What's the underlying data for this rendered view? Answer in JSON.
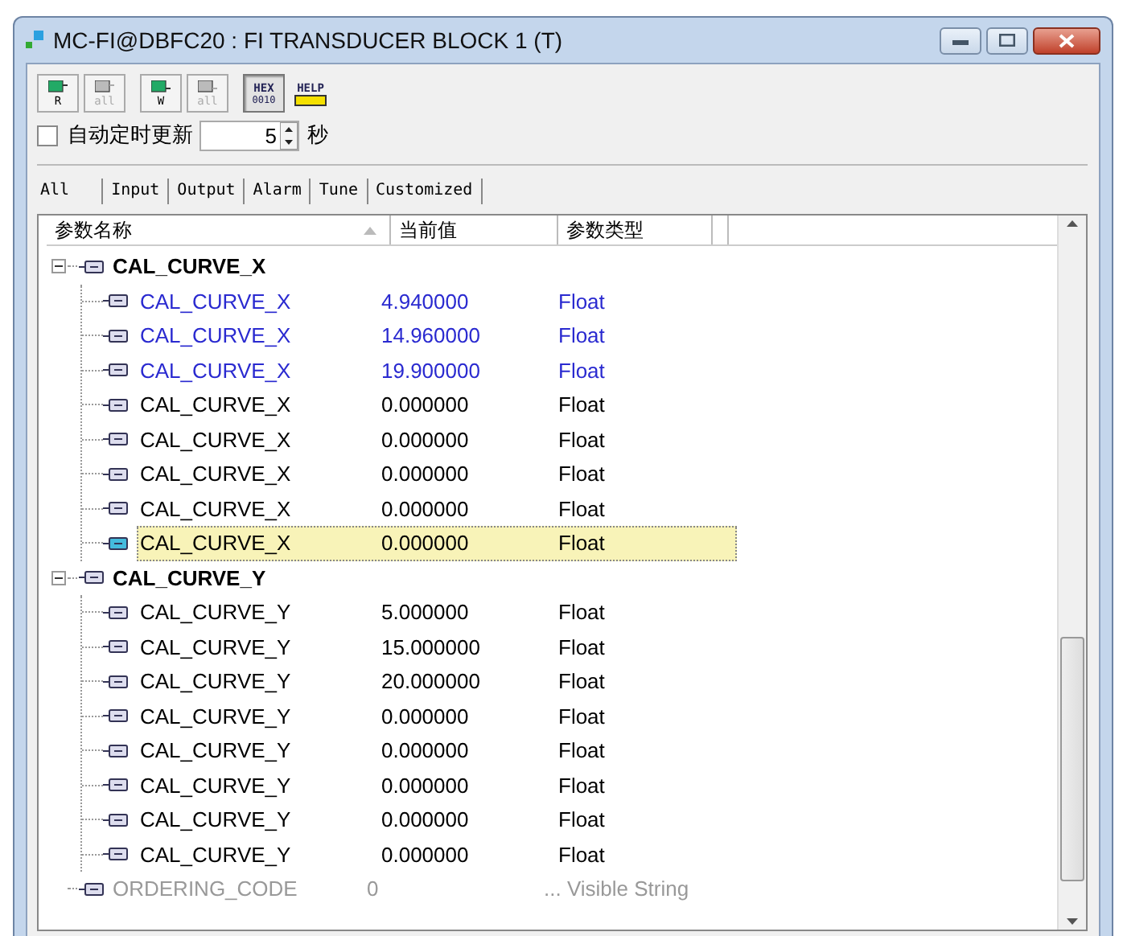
{
  "window": {
    "title": "MC-FI@DBFC20 : FI TRANSDUCER BLOCK 1 (T)"
  },
  "toolbar": [
    {
      "kind": "read",
      "label": "R",
      "disabled": false
    },
    {
      "kind": "read",
      "label": "all",
      "disabled": true
    },
    {
      "kind": "write",
      "label": "W",
      "disabled": false
    },
    {
      "kind": "write",
      "label": "all",
      "disabled": true
    },
    {
      "kind": "hex",
      "label": "HEX",
      "sublabel": "0010",
      "pressed": true
    },
    {
      "kind": "help",
      "label": "HELP",
      "pressed": false
    }
  ],
  "auto_refresh": {
    "label": "自动定时更新",
    "checked": false,
    "interval": "5",
    "unit": "秒"
  },
  "tabs": [
    {
      "label": "All",
      "selected": true
    },
    {
      "label": "Input",
      "selected": false
    },
    {
      "label": "Output",
      "selected": false
    },
    {
      "label": "Alarm",
      "selected": false
    },
    {
      "label": "Tune",
      "selected": false
    },
    {
      "label": "Customized",
      "selected": false
    }
  ],
  "table": {
    "columns": [
      {
        "label": "参数名称",
        "sorted": true
      },
      {
        "label": "当前值",
        "sorted": false
      },
      {
        "label": "参数类型",
        "sorted": false
      }
    ],
    "rows": [
      {
        "name": "CAL_CURVE_X",
        "expanded": true,
        "children": [
          {
            "name": "CAL_CURVE_X",
            "value": "4.940000",
            "type": "Float",
            "modified": true,
            "selected": false,
            "disabled": false
          },
          {
            "name": "CAL_CURVE_X",
            "value": "14.960000",
            "type": "Float",
            "modified": true,
            "selected": false,
            "disabled": false
          },
          {
            "name": "CAL_CURVE_X",
            "value": "19.900000",
            "type": "Float",
            "modified": true,
            "selected": false,
            "disabled": false
          },
          {
            "name": "CAL_CURVE_X",
            "value": "0.000000",
            "type": "Float",
            "modified": false,
            "selected": false,
            "disabled": false
          },
          {
            "name": "CAL_CURVE_X",
            "value": "0.000000",
            "type": "Float",
            "modified": false,
            "selected": false,
            "disabled": false
          },
          {
            "name": "CAL_CURVE_X",
            "value": "0.000000",
            "type": "Float",
            "modified": false,
            "selected": false,
            "disabled": false
          },
          {
            "name": "CAL_CURVE_X",
            "value": "0.000000",
            "type": "Float",
            "modified": false,
            "selected": false,
            "disabled": false
          },
          {
            "name": "CAL_CURVE_X",
            "value": "0.000000",
            "type": "Float",
            "modified": false,
            "selected": true,
            "disabled": false
          }
        ]
      },
      {
        "name": "CAL_CURVE_Y",
        "expanded": true,
        "children": [
          {
            "name": "CAL_CURVE_Y",
            "value": "5.000000",
            "type": "Float",
            "modified": false,
            "selected": false,
            "disabled": false
          },
          {
            "name": "CAL_CURVE_Y",
            "value": "15.000000",
            "type": "Float",
            "modified": false,
            "selected": false,
            "disabled": false
          },
          {
            "name": "CAL_CURVE_Y",
            "value": "20.000000",
            "type": "Float",
            "modified": false,
            "selected": false,
            "disabled": false
          },
          {
            "name": "CAL_CURVE_Y",
            "value": "0.000000",
            "type": "Float",
            "modified": false,
            "selected": false,
            "disabled": false
          },
          {
            "name": "CAL_CURVE_Y",
            "value": "0.000000",
            "type": "Float",
            "modified": false,
            "selected": false,
            "disabled": false
          },
          {
            "name": "CAL_CURVE_Y",
            "value": "0.000000",
            "type": "Float",
            "modified": false,
            "selected": false,
            "disabled": false
          },
          {
            "name": "CAL_CURVE_Y",
            "value": "0.000000",
            "type": "Float",
            "modified": false,
            "selected": false,
            "disabled": false
          },
          {
            "name": "CAL_CURVE_Y",
            "value": "0.000000",
            "type": "Float",
            "modified": false,
            "selected": false,
            "disabled": false
          }
        ]
      },
      {
        "name": "ORDERING_CODE",
        "value": "0",
        "type": "... Visible String",
        "disabled": true
      }
    ]
  }
}
